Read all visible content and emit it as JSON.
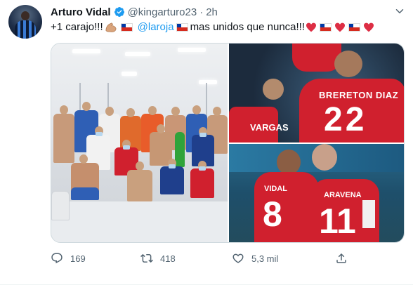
{
  "tweet": {
    "author_name": "Arturo Vidal",
    "handle": "@kingarturo23",
    "separator": "·",
    "time": "2h",
    "text_part1": "+1 carajo!!!",
    "mention": "@laroja",
    "text_part2": "mas unidos que nunca!!!",
    "jersey_names": [
      "BRERETON DIAZ",
      "VARGAS",
      "VIDAL",
      "ARAVENA"
    ],
    "jersey_numbers": [
      "22",
      "8",
      "11"
    ]
  },
  "stats": {
    "replies": "169",
    "retweets": "418",
    "likes": "5,3 mil"
  },
  "colors": {
    "accent": "#1d9bf0",
    "text_secondary": "#536471",
    "jersey_red": "#d0202e"
  }
}
